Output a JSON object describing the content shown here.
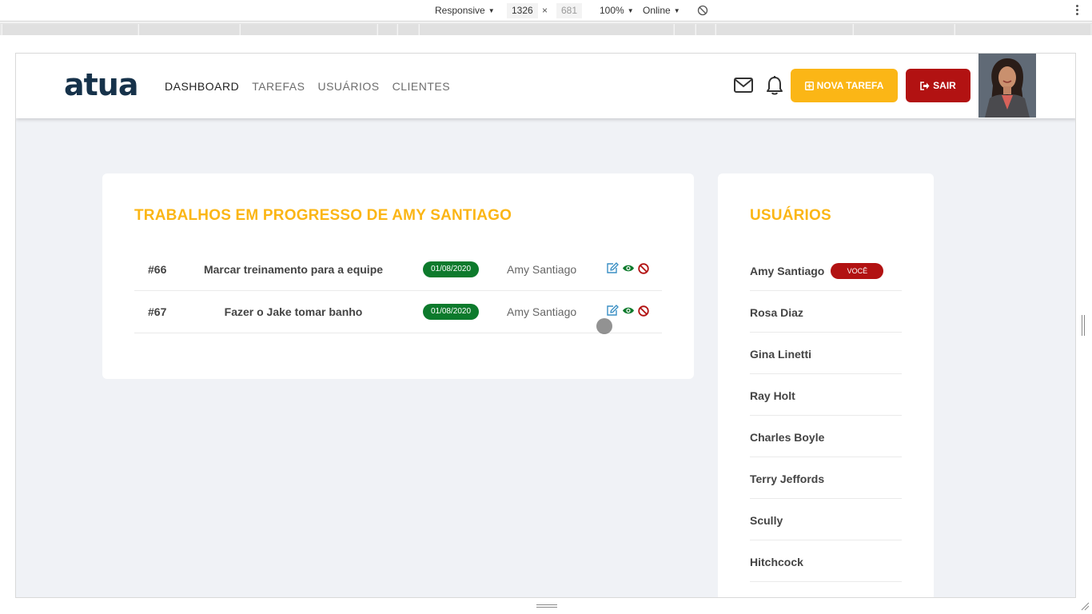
{
  "devtools": {
    "device_mode": "Responsive",
    "width": "1326",
    "separator": "×",
    "height": "681",
    "zoom": "100%",
    "network": "Online"
  },
  "header": {
    "logo": "atua",
    "nav": [
      {
        "label": "DASHBOARD",
        "active": true
      },
      {
        "label": "TAREFAS",
        "active": false
      },
      {
        "label": "USUÁRIOS",
        "active": false
      },
      {
        "label": "CLIENTES",
        "active": false
      }
    ],
    "new_task_label": "NOVA TAREFA",
    "exit_label": "SAIR",
    "colors": {
      "accent": "#fbb616",
      "danger": "#b21212",
      "brand": "#16324a"
    }
  },
  "tasks_panel": {
    "title": "TRABALHOS EM PROGRESSO DE AMY SANTIAGO",
    "rows": [
      {
        "id": "#66",
        "title": "Marcar treinamento para a equipe",
        "date": "01/08/2020",
        "owner": "Amy Santiago"
      },
      {
        "id": "#67",
        "title": "Fazer o Jake tomar banho",
        "date": "01/08/2020",
        "owner": "Amy Santiago"
      }
    ],
    "action_icons": [
      "edit-icon",
      "view-icon",
      "block-icon"
    ]
  },
  "users_panel": {
    "title": "USUÁRIOS",
    "you_badge": "VOCÊ",
    "users": [
      "Amy Santiago",
      "Rosa Diaz",
      "Gina Linetti",
      "Ray Holt",
      "Charles Boyle",
      "Terry Jeffords",
      "Scully",
      "Hitchcock"
    ]
  }
}
